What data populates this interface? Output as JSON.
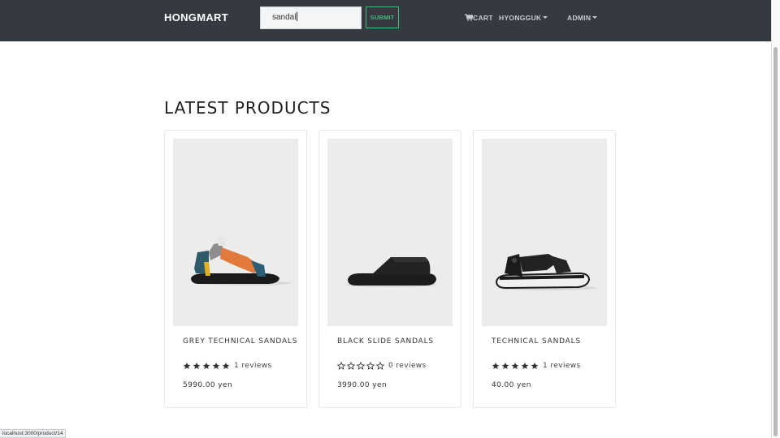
{
  "navbar": {
    "brand": "HONGMART",
    "search": {
      "value": "sandal"
    },
    "submit_label": "SUBMIT",
    "cart_label": "CART",
    "user_label": "HYONGGUK",
    "admin_label": "ADMIN"
  },
  "main": {
    "title": "LATEST PRODUCTS",
    "products": [
      {
        "name": "GREY TECHNICAL SANDALS",
        "rating": 5,
        "reviews": "1 reviews",
        "price": "5990.00 yen"
      },
      {
        "name": "BLACK SLIDE SANDALS",
        "rating": 0,
        "reviews": "0 reviews",
        "price": "3990.00 yen"
      },
      {
        "name": "TECHNICAL SANDALS",
        "rating": 5,
        "reviews": "1 reviews",
        "price": "40.00 yen"
      }
    ]
  },
  "status_bar": {
    "url": "localhost:3000/product/14"
  },
  "icons": {
    "cart": "cart-icon",
    "user_dropdown": "caret-down-icon",
    "admin_dropdown": "caret-down-icon",
    "star": "star-icon"
  },
  "colors": {
    "navbar_bg": "#343a40",
    "submit_accent": "#46b97a",
    "star": "#333333"
  }
}
